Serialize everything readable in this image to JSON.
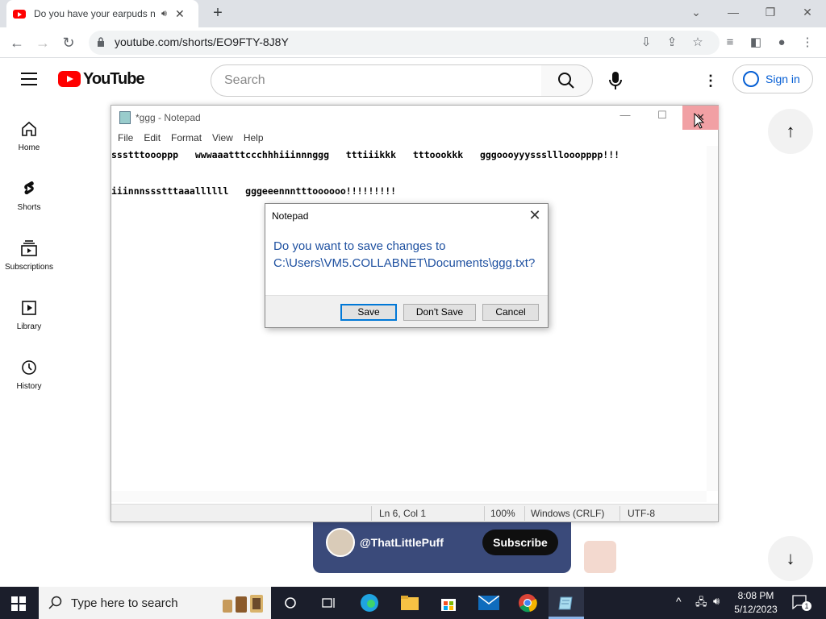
{
  "browser": {
    "tab_title": "Do you have your earpuds n",
    "new_tab": "+",
    "url": "youtube.com/shorts/EO9FTY-8J8Y"
  },
  "youtube": {
    "logo_text": "YouTube",
    "search_placeholder": "Search",
    "sign_in": "Sign in",
    "sidebar": [
      {
        "label": "Home",
        "icon": "home-icon"
      },
      {
        "label": "Shorts",
        "icon": "shorts-icon"
      },
      {
        "label": "Subscriptions",
        "icon": "subscriptions-icon"
      },
      {
        "label": "Library",
        "icon": "library-icon"
      },
      {
        "label": "History",
        "icon": "history-icon"
      }
    ],
    "channel": "@ThatLittlePuff",
    "subscribe": "Subscribe"
  },
  "notepad": {
    "title": "*ggg - Notepad",
    "menu": [
      "File",
      "Edit",
      "Format",
      "View",
      "Help"
    ],
    "text": "ssstttoooppp   wwwaaatttccchhhiiinnnggg   tttiiikkk   tttoookkk   gggoooyyyssslllooopppp!!!\n\niiinnnssstttaaallllll   gggeeennntttoooooo!!!!!!!!!",
    "status": {
      "position": "Ln 6, Col 1",
      "zoom": "100%",
      "line_ending": "Windows (CRLF)",
      "encoding": "UTF-8"
    }
  },
  "dialog": {
    "title": "Notepad",
    "message_line1": "Do you want to save changes to",
    "message_line2": "C:\\Users\\VM5.COLLABNET\\Documents\\ggg.txt?",
    "save": "Save",
    "dont_save": "Don't Save",
    "cancel": "Cancel"
  },
  "taskbar": {
    "search_placeholder": "Type here to search",
    "time": "8:08 PM",
    "date": "5/12/2023",
    "notification_count": "1"
  },
  "colors": {
    "youtube_red": "#ff0000",
    "link_blue": "#065fd4",
    "dialog_text": "#1e50a0",
    "taskbar_bg": "#1b1e2b",
    "close_hover": "#f1a0a4"
  }
}
